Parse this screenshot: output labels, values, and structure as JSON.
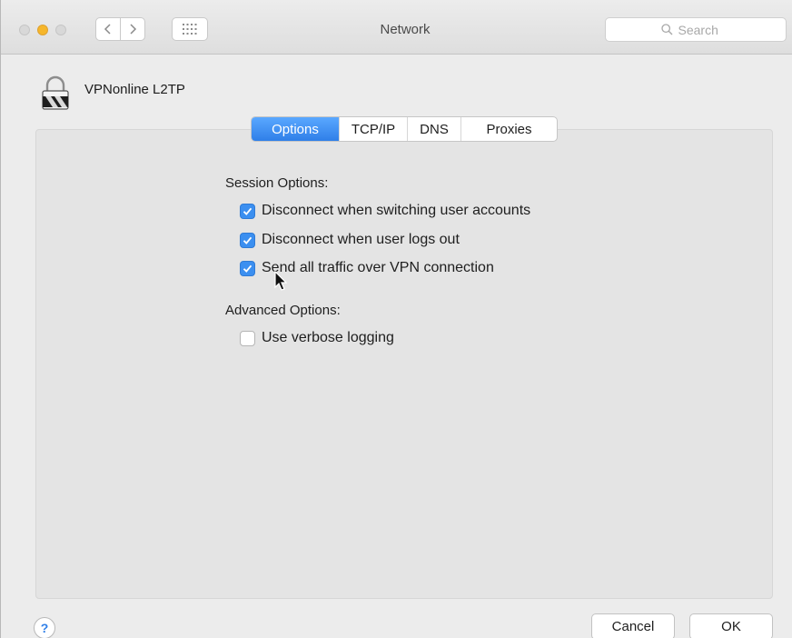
{
  "window": {
    "title": "Network"
  },
  "search": {
    "placeholder": "Search"
  },
  "connection": {
    "name": "VPNonline L2TP"
  },
  "tabs": [
    {
      "label": "Options",
      "active": true
    },
    {
      "label": "TCP/IP",
      "active": false
    },
    {
      "label": "DNS",
      "active": false
    },
    {
      "label": "Proxies",
      "active": false
    }
  ],
  "session": {
    "heading": "Session Options:",
    "options": [
      {
        "label": "Disconnect when switching user accounts",
        "checked": true
      },
      {
        "label": "Disconnect when user logs out",
        "checked": true
      },
      {
        "label": "Send all traffic over VPN connection",
        "checked": true
      }
    ]
  },
  "advanced": {
    "heading": "Advanced Options:",
    "options": [
      {
        "label": "Use verbose logging",
        "checked": false
      }
    ]
  },
  "footer": {
    "help_label": "?",
    "cancel_label": "Cancel",
    "ok_label": "OK"
  },
  "colors": {
    "accent": "#2f7fe8",
    "checkbox_on": "#3b8ff0",
    "minimize_light": "#f6b62a"
  }
}
